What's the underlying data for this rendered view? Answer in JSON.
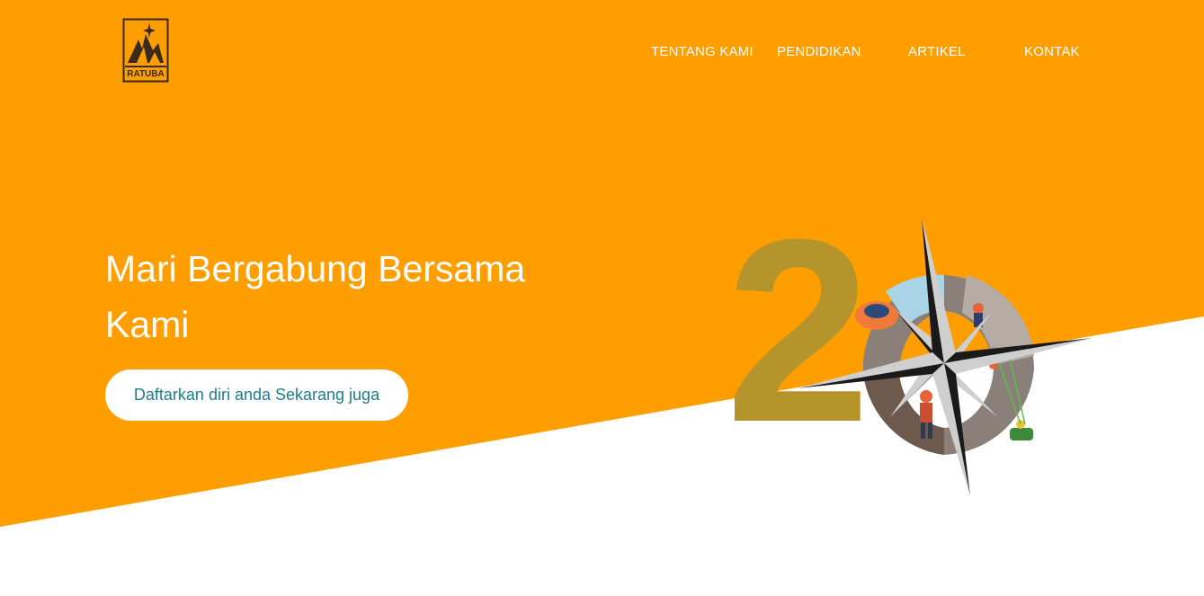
{
  "brand": {
    "logo_text": "RATUBA",
    "colors": {
      "primary": "#FF9E00",
      "logo_dark": "#3a2a1a",
      "cta_text": "#1d7d8a",
      "numeral": "#B5942B"
    }
  },
  "nav": {
    "items": [
      {
        "label": "TENTANG KAMI"
      },
      {
        "label": "PENDIDIKAN"
      },
      {
        "label": "ARTIKEL"
      },
      {
        "label": "KONTAK"
      }
    ]
  },
  "hero": {
    "headline": "Mari Bergabung Bersama Kami",
    "cta_label": "Daftarkan diri anda Sekarang juga"
  },
  "emblem": {
    "numeral": "20",
    "icon": "compass-rose-icon"
  }
}
